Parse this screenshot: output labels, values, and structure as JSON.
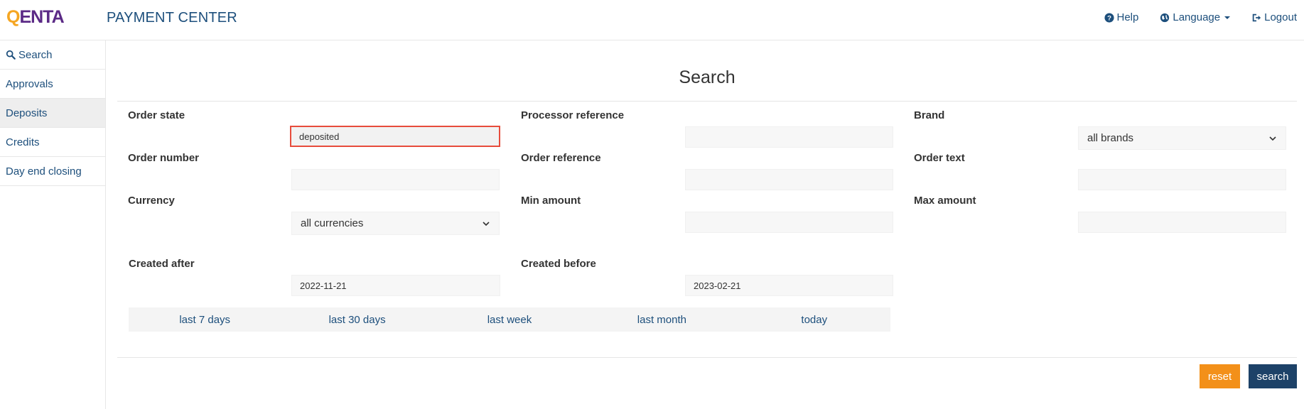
{
  "header": {
    "logo_q": "Q",
    "logo_rest": "ENTA",
    "app_title": "PAYMENT CENTER",
    "nav": {
      "help": "Help",
      "language": "Language",
      "logout": "Logout"
    }
  },
  "sidebar": {
    "items": [
      {
        "label": "Search",
        "icon": "search-icon"
      },
      {
        "label": "Approvals"
      },
      {
        "label": "Deposits",
        "active": true
      },
      {
        "label": "Credits"
      },
      {
        "label": "Day end closing"
      }
    ]
  },
  "main": {
    "title": "Search",
    "fields": {
      "order_state": {
        "label": "Order state",
        "value": "deposited"
      },
      "processor_reference": {
        "label": "Processor reference",
        "value": ""
      },
      "brand": {
        "label": "Brand",
        "value": "all brands"
      },
      "order_number": {
        "label": "Order number",
        "value": ""
      },
      "order_reference": {
        "label": "Order reference",
        "value": ""
      },
      "order_text": {
        "label": "Order text",
        "value": ""
      },
      "currency": {
        "label": "Currency",
        "value": "all currencies"
      },
      "min_amount": {
        "label": "Min amount",
        "value": ""
      },
      "max_amount": {
        "label": "Max amount",
        "value": ""
      },
      "created_after": {
        "label": "Created after",
        "value": "2022-11-21"
      },
      "created_before": {
        "label": "Created before",
        "value": "2023-02-21"
      }
    },
    "quick_ranges": [
      "last 7 days",
      "last 30 days",
      "last week",
      "last month",
      "today"
    ],
    "buttons": {
      "reset": "reset",
      "search": "search"
    }
  },
  "colors": {
    "link": "#1d4f7c",
    "reset": "#f39019",
    "search": "#1d4268",
    "error_border": "#e74c3c"
  }
}
